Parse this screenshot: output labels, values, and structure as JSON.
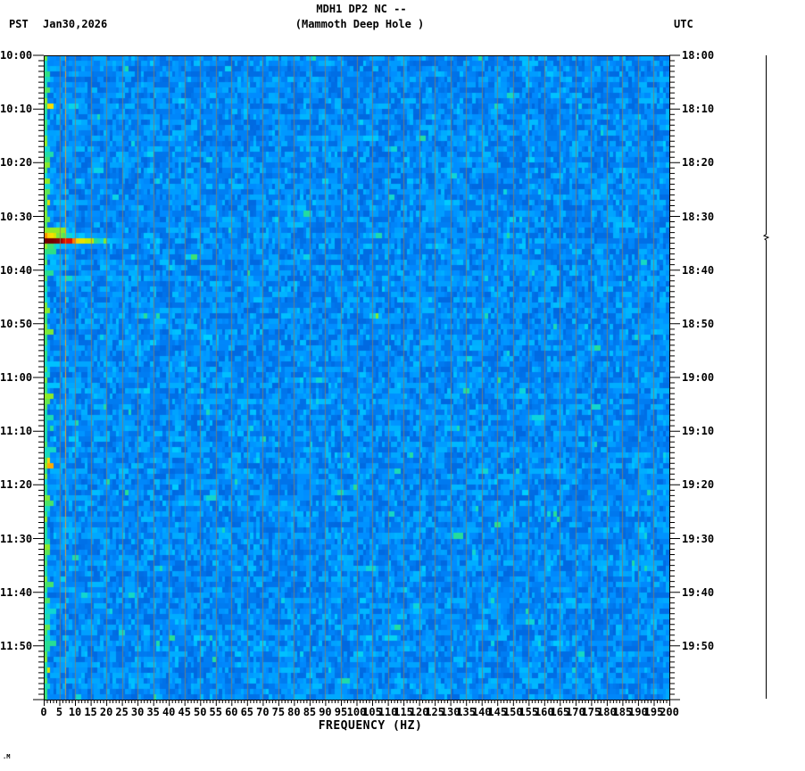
{
  "header": {
    "tz_left": "PST",
    "date": "Jan30,2026",
    "title": "MDH1 DP2 NC --",
    "subtitle": "(Mammoth Deep Hole )",
    "tz_right": "UTC"
  },
  "corner_mark": ".M",
  "chart_data": {
    "type": "heatmap",
    "title": "MDH1 DP2 NC --",
    "subtitle": "(Mammoth Deep Hole )",
    "station": "MDH1 DP2 NC",
    "station_description": "Mammoth Deep Hole",
    "date": "Jan30,2026",
    "xlabel": "FREQUENCY (HZ)",
    "x_range_hz": [
      0,
      200
    ],
    "x_major_tick_step_hz": 5,
    "x_minor_tick_step_hz": 1,
    "x_tick_labels": [
      "0",
      "5",
      "10",
      "15",
      "20",
      "25",
      "30",
      "35",
      "40",
      "45",
      "50",
      "55",
      "60",
      "65",
      "70",
      "75",
      "80",
      "85",
      "90",
      "95",
      "100",
      "105",
      "110",
      "115",
      "120",
      "125",
      "130",
      "135",
      "140",
      "145",
      "150",
      "155",
      "160",
      "165",
      "170",
      "175",
      "180",
      "185",
      "190",
      "195",
      "200"
    ],
    "left_axis": {
      "timezone": "PST",
      "start": "10:00",
      "end": "12:00",
      "major_tick_step_min": 10,
      "minor_tick_step_min": 1,
      "tick_labels": [
        "10:00",
        "10:10",
        "10:20",
        "10:30",
        "10:40",
        "10:50",
        "11:00",
        "11:10",
        "11:20",
        "11:30",
        "11:40",
        "11:50"
      ]
    },
    "right_axis": {
      "timezone": "UTC",
      "start": "18:00",
      "end": "20:00",
      "major_tick_step_min": 10,
      "minor_tick_step_min": 1,
      "tick_labels": [
        "18:00",
        "18:10",
        "18:20",
        "18:30",
        "18:40",
        "18:50",
        "19:00",
        "19:10",
        "19:20",
        "19:30",
        "19:40",
        "19:50"
      ]
    },
    "grid": {
      "vertical_every_hz": 5,
      "color": "#8a8064",
      "alpha": 0.8
    },
    "background_noise": {
      "description": "blue speckled ambient-noise spectrogram, 1 Hz x 1 min cells",
      "cell_hz": 1,
      "cell_min": 1,
      "rows_min": 120,
      "cols_hz": 200,
      "seed": 1337,
      "colormap": [
        [
          0.0,
          "#0040b8"
        ],
        [
          0.22,
          "#0068e0"
        ],
        [
          0.42,
          "#008cff"
        ],
        [
          0.58,
          "#00acff"
        ],
        [
          0.68,
          "#00d0ff"
        ],
        [
          0.75,
          "#30e080"
        ],
        [
          0.82,
          "#b8ee00"
        ],
        [
          0.87,
          "#ffdc00"
        ],
        [
          0.92,
          "#ff8c00"
        ],
        [
          0.96,
          "#f01400"
        ],
        [
          1.02,
          "#a00000"
        ],
        [
          1.12,
          "#700000"
        ]
      ]
    },
    "features": {
      "event": {
        "name": "seismic-event",
        "time_pst": "10:34",
        "time_utc": "18:34",
        "duration_min": 3,
        "freq_extent_hz": [
          0,
          30
        ],
        "peak_freq_hz": [
          0,
          8
        ],
        "peak_color": "dark red",
        "rows": [
          {
            "minute": 33,
            "peak_v": 0.9,
            "slope_per_hz": 0.03
          },
          {
            "minute": 34,
            "peak_v": 1.13,
            "slope_per_hz": 0.026
          },
          {
            "minute": 35,
            "peak_v": 0.76,
            "slope_per_hz": 0.028
          }
        ]
      },
      "narrowband_line": {
        "name": "persistent-narrowband-signal",
        "freq_hz": 6.9,
        "color": "#f5a020"
      },
      "low_freq_edge_band": {
        "freq_hz": [
          0,
          1
        ],
        "min_v": 0.7,
        "color": "green-cyan"
      }
    },
    "side_trace": {
      "description": "amplitude trace at right margin, flat except small blip at event time",
      "color": "#000000",
      "blip_time_pst": "10:34"
    },
    "legend_position": "none",
    "grid_on": true
  }
}
